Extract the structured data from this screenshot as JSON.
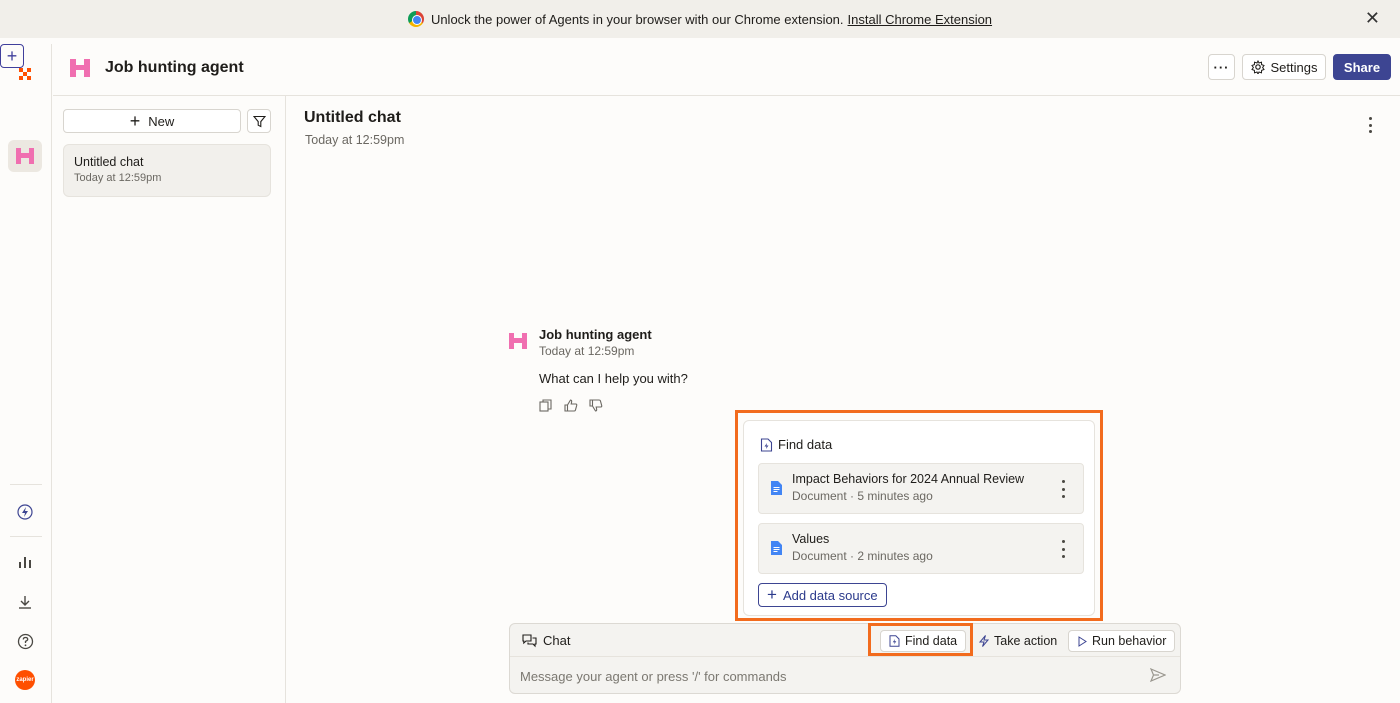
{
  "banner": {
    "message": "Unlock the power of Agents in your browser with our Chrome extension.",
    "link": "Install Chrome Extension",
    "close": "✕"
  },
  "rail": {
    "new_symbol": "+",
    "zapier_badge": "zapier"
  },
  "header": {
    "title": "Job hunting agent",
    "more_label": "···",
    "settings_label": "Settings",
    "share_label": "Share"
  },
  "chat_list": {
    "new_label": "New",
    "items": [
      {
        "name": "Untitled chat",
        "time": "Today at 12:59pm"
      }
    ]
  },
  "chat": {
    "title": "Untitled chat",
    "time": "Today at 12:59pm",
    "message": {
      "sender": "Job hunting agent",
      "time": "Today at 12:59pm",
      "text": "What can I help you with?"
    }
  },
  "find_data": {
    "heading": "Find data",
    "sources": [
      {
        "name": "Impact Behaviors for 2024 Annual Review",
        "meta": "Document · 5 minutes ago"
      },
      {
        "name": "Values",
        "meta": "Document · 2 minutes ago"
      }
    ],
    "add_label": "Add data source"
  },
  "composer": {
    "mode_label": "Chat",
    "find_data_label": "Find data",
    "take_action_label": "Take action",
    "run_behavior_label": "Run behavior",
    "placeholder": "Message your agent or press '/' for commands"
  },
  "colors": {
    "accent": "#3d4592",
    "highlight": "#f26b1d",
    "agent_pink": "#f06fb0",
    "zapier_orange": "#ff4f00"
  }
}
